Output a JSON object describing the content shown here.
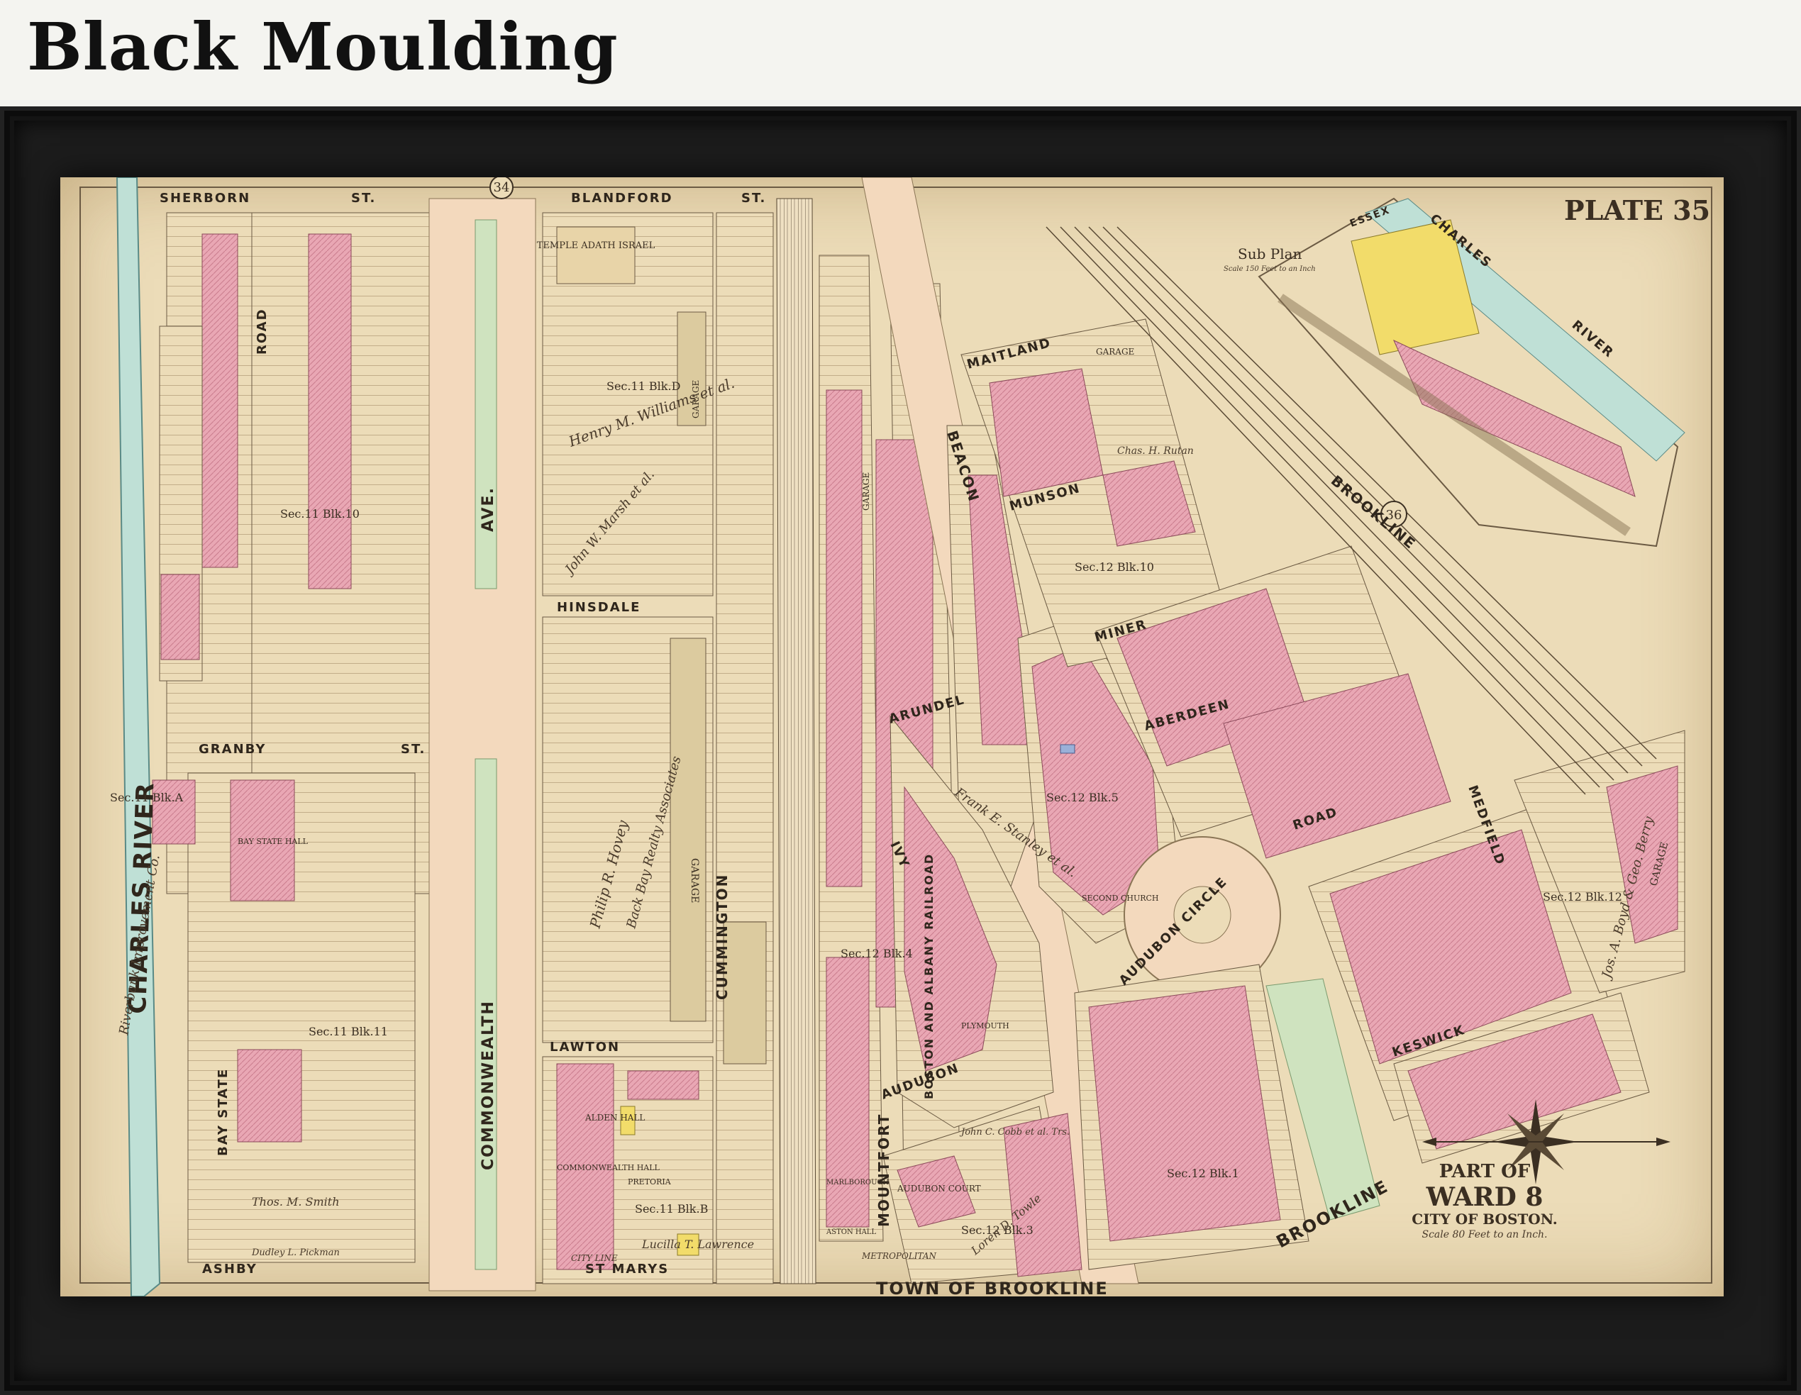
{
  "page": {
    "heading": "Black Moulding"
  },
  "map": {
    "plate": "PLATE 35",
    "title_line1": "PART OF",
    "title_line2": "WARD 8",
    "title_line3": "CITY OF BOSTON.",
    "scale": "Scale 80 Feet to an Inch.",
    "sub_plan": "Sub Plan",
    "sub_plan_scale": "Scale 150 Feet to an Inch",
    "colors": {
      "brick": "#e9a7b4",
      "paper": "#ecdcb8",
      "road": "#f3d9bd",
      "park": "#cfe3bf",
      "stone": "#f2dc6a"
    },
    "streets": {
      "sherborn": "SHERBORN",
      "st": "ST.",
      "blandford": "BLANDFORD",
      "hinsdale": "HINSDALE",
      "granby": "GRANBY",
      "lawton": "LAWTON",
      "ashby": "ASHBY",
      "st_marys": "ST MARYS",
      "commonwealth": "COMMONWEALTH",
      "ave": "AVE.",
      "bay_state": "BAY STATE",
      "road": "ROAD",
      "cummington": "CUMMINGTON",
      "mountfort": "MOUNTFORT",
      "beacon": "BEACON",
      "maitland": "MAITLAND",
      "munson": "MUNSON",
      "miner": "MINER",
      "arundel": "ARUNDEL",
      "aberdeen": "ABERDEEN",
      "ivy": "IVY",
      "audubon": "AUDUBON",
      "audubon_circle": "AUDUBON CIRCLE",
      "medfield": "MEDFIELD",
      "keswick": "KESWICK",
      "brookline": "BROOKLINE",
      "essex": "ESSEX",
      "charles": "CHARLES",
      "river": "RIVER",
      "charles_river_vertical": "CHARLES RIVER",
      "town_of_brookline": "TOWN OF BROOKLINE",
      "boston_albany": "BOSTON AND ALBANY RAILROAD",
      "metropolitan": "METROPOLITAN",
      "city_line": "CITY LINE",
      "riverbank": "Riverbank Improvement Co."
    },
    "landmarks": {
      "temple": "TEMPLE ADATH ISRAEL",
      "garage": "GARAGE",
      "alden_hall": "ALDEN HALL",
      "bay_state_hall": "BAY STATE HALL",
      "second_church": "SECOND CHURCH",
      "audubon_court": "AUDUBON COURT",
      "pretoria": "PRETORIA",
      "commonwealth_hall": "COMMONWEALTH HALL",
      "plymouth": "PLYMOUTH",
      "marlborough": "MARLBOROUGH",
      "aston_hall": "ASTON HALL"
    },
    "sections": {
      "s1": "Sec.11 Blk.10",
      "s2": "Sec.11 Blk.11",
      "s3": "Sec.11 Blk.D",
      "s4": "Sec.11 Blk.A",
      "s5": "Sec.12 Blk.5",
      "s6": "Sec.12 Blk.10",
      "s7": "Sec.12 Blk.12",
      "s8": "Sec.12 Blk.3",
      "s9": "Sec.12 Blk.1",
      "s10": "Sec.11 Blk.B",
      "s11": "Sec.12 Blk.4"
    },
    "owners": {
      "o1": "Henry M. Williams et al.",
      "o2": "John W. Marsh et al.",
      "o3": "Philip R. Hovey",
      "o4": "Back Bay Realty Associates",
      "o5": "Frank E. Stanley et al.",
      "o6": "Thos. M. Smith",
      "o7": "Lucilla T. Lawrence",
      "o8": "Loren D. Towle",
      "o9": "John C. Cobb et al. Trs.",
      "o10": "Dudley L. Pickman",
      "o11": "Jos. A. Boyd & Geo. Berry",
      "o12": "Chas. H. Rutan"
    },
    "circles": {
      "c34": "34",
      "c36": "36"
    }
  }
}
